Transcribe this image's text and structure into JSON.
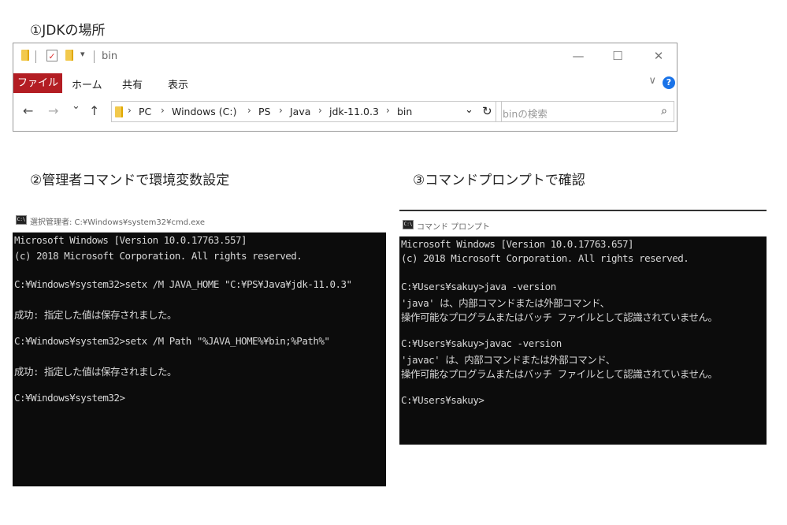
{
  "headings": {
    "h1": "①JDKの場所",
    "h2": "②管理者コマンドで環境変数設定",
    "h3": "③コマンドプロンプトで確認"
  },
  "explorer": {
    "title": "bin",
    "quick_access_arrow": "▾",
    "window_controls": {
      "minimize": "—",
      "maximize": "☐",
      "close": "✕"
    },
    "ribbon": {
      "file_tab": "ファイル",
      "tabs": [
        "ホーム",
        "共有",
        "表示"
      ],
      "help": "?",
      "expand": "∨"
    },
    "nav": {
      "back": "←",
      "forward": "→",
      "recent": "⌄",
      "up": "↑",
      "refresh": "↻",
      "dropdown": "⌄"
    },
    "breadcrumb": [
      "PC",
      "Windows (C:)",
      "PS",
      "Java",
      "jdk-11.0.3",
      "bin"
    ],
    "search_placeholder": "binの検索",
    "search_icon": "⌕"
  },
  "console_admin": {
    "title": "選択管理者: C:¥Windows¥system32¥cmd.exe",
    "lines": [
      "Microsoft Windows [Version 10.0.17763.557]",
      "(c) 2018 Microsoft Corporation. All rights reserved.",
      "",
      "C:¥Windows¥system32>setx /M JAVA_HOME \"C:¥PS¥Java¥jdk-11.0.3\"",
      "",
      "成功: 指定した値は保存されました。",
      "",
      "C:¥Windows¥system32>setx /M Path \"%JAVA_HOME%¥bin;%Path%\"",
      "",
      "成功: 指定した値は保存されました。",
      "",
      "C:¥Windows¥system32>"
    ]
  },
  "console_user": {
    "title": "コマンド プロンプト",
    "lines": [
      "Microsoft Windows [Version 10.0.17763.657]",
      "(c) 2018 Microsoft Corporation. All rights reserved.",
      "",
      "C:¥Users¥sakuy>java -version",
      "'java' は、内部コマンドまたは外部コマンド、",
      "操作可能なプログラムまたはバッチ ファイルとして認識されていません。",
      "",
      "C:¥Users¥sakuy>javac -version",
      "'javac' は、内部コマンドまたは外部コマンド、",
      "操作可能なプログラムまたはバッチ ファイルとして認識されていません。",
      "",
      "C:¥Users¥sakuy>"
    ]
  },
  "colors": {
    "file_tab": "#b31d23",
    "console_bg": "#0c0c0c",
    "console_text": "#d8d8d8",
    "help_icon": "#1a73e8",
    "folder": "#f2c94c"
  }
}
